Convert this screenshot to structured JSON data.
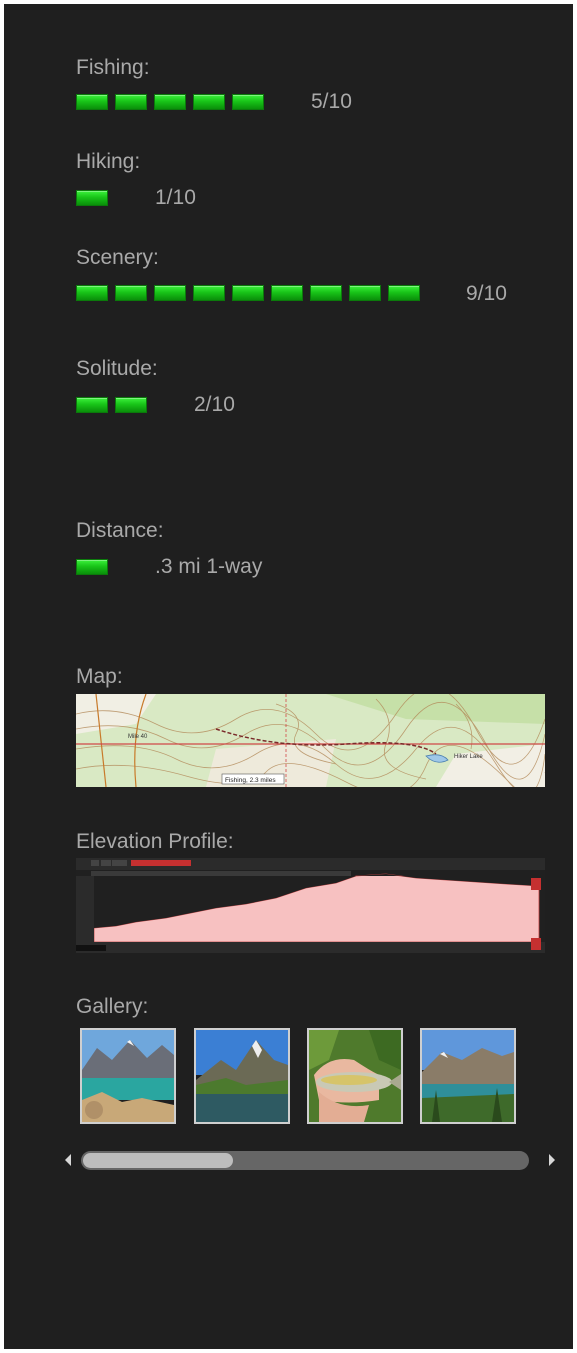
{
  "ratings": [
    {
      "label": "Fishing:",
      "score_text": "5/10",
      "value": 5
    },
    {
      "label": "Hiking:",
      "score_text": "1/10",
      "value": 1
    },
    {
      "label": "Scenery:",
      "score_text": "9/10",
      "value": 9
    },
    {
      "label": "Solitude:",
      "score_text": "2/10",
      "value": 2
    }
  ],
  "distance": {
    "label": "Distance:",
    "value_text": ".3 mi 1-way",
    "bar_count": 1
  },
  "map": {
    "label": "Map:",
    "place_labels": [
      "Mile 40",
      "Hiker Lake"
    ],
    "callout": "Fishing, 2.3 miles"
  },
  "elevation": {
    "label": "Elevation Profile:"
  },
  "gallery": {
    "label": "Gallery:",
    "thumbnails": [
      {
        "name": "gallery-thumb-lake-peaks"
      },
      {
        "name": "gallery-thumb-mountain-lake"
      },
      {
        "name": "gallery-thumb-trout-in-hand"
      },
      {
        "name": "gallery-thumb-lake-trees"
      }
    ]
  },
  "scrollbar": {
    "position": 0
  }
}
